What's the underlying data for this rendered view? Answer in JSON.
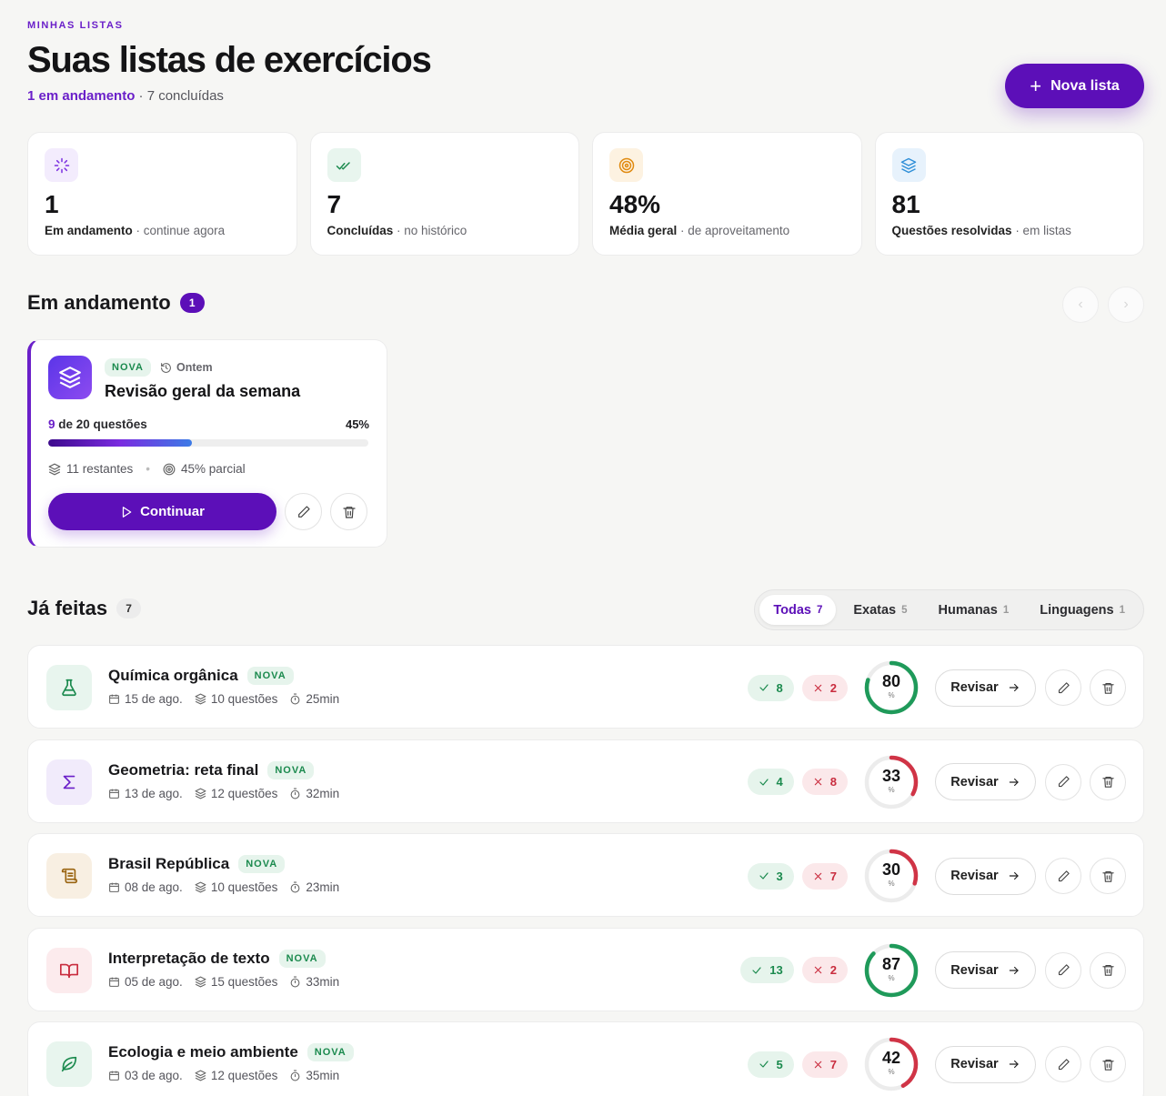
{
  "header": {
    "eyebrow": "MINHAS LISTAS",
    "title": "Suas listas de exercícios",
    "in_progress_text": "1 em andamento",
    "done_text": " · 7 concluídas",
    "new_button": "Nova lista"
  },
  "stats": [
    {
      "icon": "loader-icon",
      "value": "1",
      "label": "Em andamento",
      "sub": " · continue agora",
      "color": "#7b2ee0",
      "bg": "#f3ecfd"
    },
    {
      "icon": "check-double-icon",
      "value": "7",
      "label": "Concluídas",
      "sub": " · no histórico",
      "color": "#1b8a4e",
      "bg": "#e8f5ee"
    },
    {
      "icon": "target-icon",
      "value": "48%",
      "label": "Média geral",
      "sub": " · de aproveitamento",
      "color": "#e08a10",
      "bg": "#fdf2e1"
    },
    {
      "icon": "layers-icon",
      "value": "81",
      "label": "Questões resolvidas",
      "sub": " · em listas",
      "color": "#2f8fd8",
      "bg": "#e7f2fc"
    }
  ],
  "in_progress": {
    "title": "Em andamento",
    "count": "1",
    "card": {
      "tag": "NOVA",
      "when": "Ontem",
      "title": "Revisão geral da semana",
      "answered": "9",
      "total_text": " de 20 questões",
      "percent_label": "45%",
      "progress": 0.45,
      "remaining": "11 restantes",
      "partial": "45% parcial",
      "continue_label": "Continuar"
    }
  },
  "done": {
    "title": "Já feitas",
    "count": "7",
    "tabs": [
      {
        "label": "Todas",
        "count": "7",
        "active": true
      },
      {
        "label": "Exatas",
        "count": "5",
        "active": false
      },
      {
        "label": "Humanas",
        "count": "1",
        "active": false
      },
      {
        "label": "Linguagens",
        "count": "1",
        "active": false
      }
    ],
    "review_label": "Revisar",
    "items": [
      {
        "title": "Química orgânica",
        "tag": "NOVA",
        "date": "15 de ago.",
        "questions": "10 questões",
        "time": "25min",
        "ok": "8",
        "bad": "2",
        "score": "80",
        "score_value": 80,
        "icon": "flask-icon",
        "icon_color": "#1b8a4e",
        "icon_bg": "#e8f5ee",
        "ring_color": "#1f9a5a"
      },
      {
        "title": "Geometria: reta final",
        "tag": "NOVA",
        "date": "13 de ago.",
        "questions": "12 questões",
        "time": "32min",
        "ok": "4",
        "bad": "8",
        "score": "33",
        "score_value": 33,
        "icon": "sigma-icon",
        "icon_color": "#6a1fc9",
        "icon_bg": "#f1ebfb",
        "ring_color": "#d03446"
      },
      {
        "title": "Brasil República",
        "tag": "NOVA",
        "date": "08 de ago.",
        "questions": "10 questões",
        "time": "23min",
        "ok": "3",
        "bad": "7",
        "score": "30",
        "score_value": 30,
        "icon": "scroll-icon",
        "icon_color": "#9a6410",
        "icon_bg": "#f8efe2",
        "ring_color": "#d03446"
      },
      {
        "title": "Interpretação de texto",
        "tag": "NOVA",
        "date": "05 de ago.",
        "questions": "15 questões",
        "time": "33min",
        "ok": "13",
        "bad": "2",
        "score": "87",
        "score_value": 87,
        "icon": "book-open-icon",
        "icon_color": "#c92c3e",
        "icon_bg": "#fcebed",
        "ring_color": "#1f9a5a"
      },
      {
        "title": "Ecologia e meio ambiente",
        "tag": "NOVA",
        "date": "03 de ago.",
        "questions": "12 questões",
        "time": "35min",
        "ok": "5",
        "bad": "7",
        "score": "42",
        "score_value": 42,
        "icon": "leaf-icon",
        "icon_color": "#1b8a4e",
        "icon_bg": "#e8f5ee",
        "ring_color": "#d03446"
      }
    ]
  },
  "score_suffix": "%"
}
